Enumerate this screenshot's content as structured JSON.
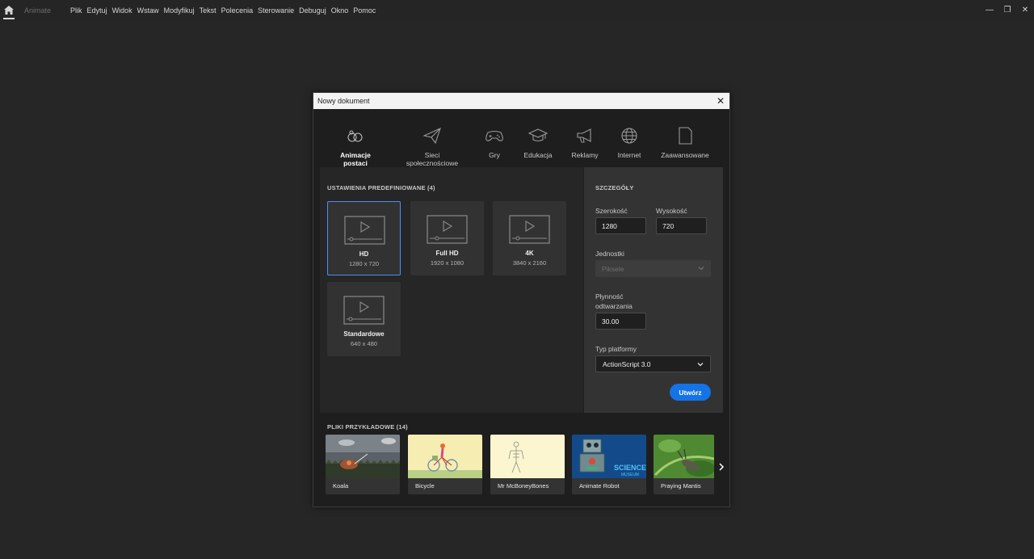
{
  "menubar": {
    "app_name": "Animate",
    "items": [
      "Plik",
      "Edytuj",
      "Widok",
      "Wstaw",
      "Modyfikuj",
      "Tekst",
      "Polecenia",
      "Sterowanie",
      "Debuguj",
      "Okno",
      "Pomoc"
    ]
  },
  "window_controls": {
    "minimize": "—",
    "restore": "❐",
    "close": "✕"
  },
  "dialog": {
    "title": "Nowy dokument",
    "close_glyph": "✕",
    "categories": [
      {
        "label": "Animacje postaci",
        "icon": "character-animation-icon",
        "active": true
      },
      {
        "label": "Sieci społecznościowe",
        "icon": "paper-plane-icon",
        "active": false
      },
      {
        "label": "Gry",
        "icon": "gamepad-icon",
        "active": false
      },
      {
        "label": "Edukacja",
        "icon": "graduation-cap-icon",
        "active": false
      },
      {
        "label": "Reklamy",
        "icon": "megaphone-icon",
        "active": false
      },
      {
        "label": "Internet",
        "icon": "globe-icon",
        "active": false
      },
      {
        "label": "Zaawansowane",
        "icon": "document-icon",
        "active": false
      }
    ],
    "presets": {
      "title": "USTAWIENIA PREDEFINIOWANE (4)",
      "items": [
        {
          "name": "HD",
          "size": "1280 x 720",
          "selected": true
        },
        {
          "name": "Full HD",
          "size": "1920 x 1080",
          "selected": false
        },
        {
          "name": "4K",
          "size": "3840 x 2160",
          "selected": false
        },
        {
          "name": "Standardowe",
          "size": "640 x 480",
          "selected": false
        }
      ]
    },
    "details": {
      "title": "SZCZEGÓŁY",
      "width_label": "Szerokość",
      "width_value": "1280",
      "height_label": "Wysokość",
      "height_value": "720",
      "units_label": "Jednostki",
      "units_value": "Piksele",
      "framerate_label_line1": "Płynność",
      "framerate_label_line2": "odtwarzania",
      "framerate_value": "30.00",
      "platform_label": "Typ platformy",
      "platform_value": "ActionScript 3.0",
      "create_label": "Utwórz"
    },
    "samples": {
      "title": "PLIKI PRZYKŁADOWE (14)",
      "items": [
        {
          "name": "Koala"
        },
        {
          "name": "Bicycle"
        },
        {
          "name": "Mr McBoneyBones"
        },
        {
          "name": "Animate Robot",
          "thumb_text_1": "SCIENCE",
          "thumb_text_2": "MUSEUM"
        },
        {
          "name": "Praying Mantis"
        }
      ]
    }
  },
  "colors": {
    "accent": "#1473e6",
    "selected_border": "#4b8ff5",
    "background": "#262626"
  }
}
